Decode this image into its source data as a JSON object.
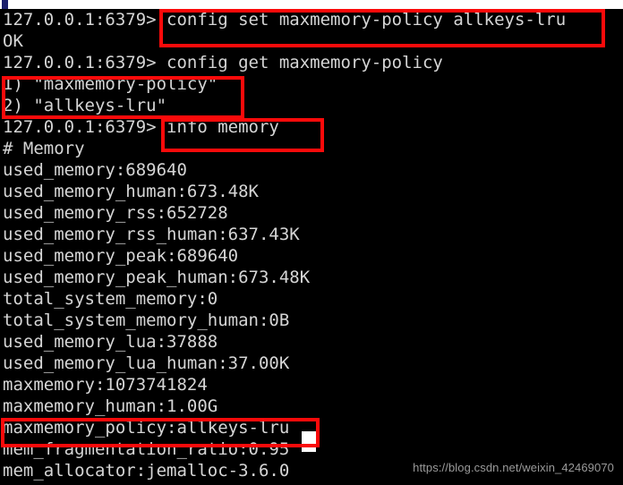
{
  "window": {
    "kind": "terminal",
    "background_color": "#000000",
    "foreground_color": "#d5d5d5",
    "annotation_color": "#fb0a0a",
    "cursor_color": "#ffffff"
  },
  "terminal": {
    "prompt": "127.0.0.1:6379>",
    "lines": [
      "127.0.0.1:6379> config set maxmemory-policy allkeys-lru",
      "OK",
      "127.0.0.1:6379> config get maxmemory-policy",
      "1) \"maxmemory-policy\"",
      "2) \"allkeys-lru\"",
      "127.0.0.1:6379> info memory",
      "# Memory",
      "used_memory:689640",
      "used_memory_human:673.48K",
      "used_memory_rss:652728",
      "used_memory_rss_human:637.43K",
      "used_memory_peak:689640",
      "used_memory_peak_human:673.48K",
      "total_system_memory:0",
      "total_system_memory_human:0B",
      "used_memory_lua:37888",
      "used_memory_lua_human:37.00K",
      "maxmemory:1073741824",
      "maxmemory_human:1.00G",
      "maxmemory_policy:allkeys-lru",
      "mem_fragmentation_ratio:0.95",
      "mem_allocator:jemalloc-3.6.0"
    ]
  },
  "annotations": [
    {
      "id": "annot-1",
      "target": "config set maxmemory-policy allkeys-lru"
    },
    {
      "id": "annot-2",
      "target": "1) \"maxmemory-policy\"  2) \"allkeys-lru\""
    },
    {
      "id": "annot-3",
      "target": "info memory"
    },
    {
      "id": "annot-4",
      "target": "maxmemory_policy:allkeys-lru"
    }
  ],
  "watermark": {
    "text": "https://blog.csdn.net/weixin_42469070"
  }
}
